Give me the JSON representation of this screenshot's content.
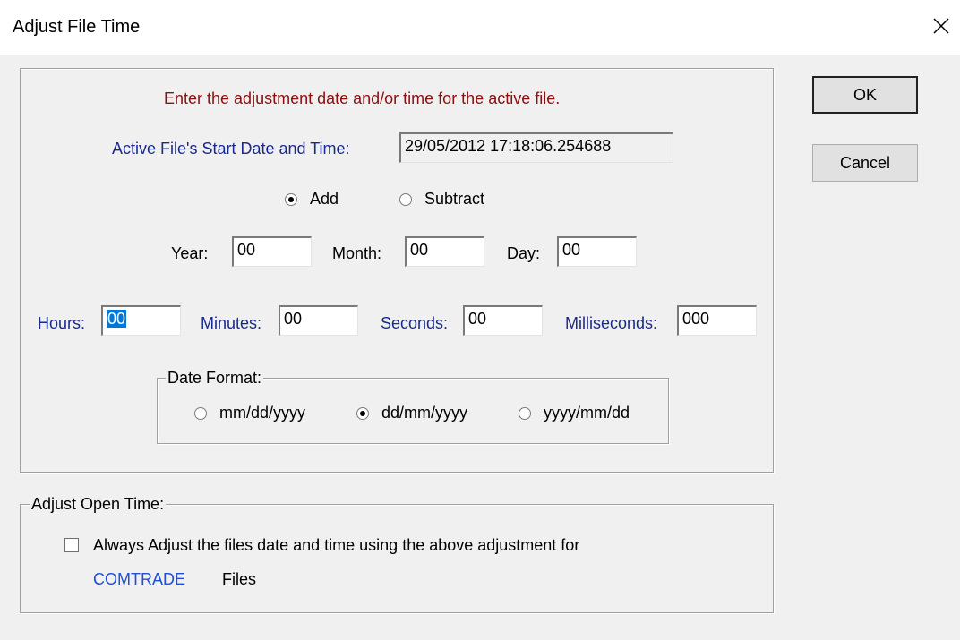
{
  "window": {
    "title": "Adjust File Time"
  },
  "dialog": {
    "instruction": "Enter the adjustment date and/or time for the active file.",
    "start_label": "Active File's Start Date and Time:",
    "start_value": "29/05/2012 17:18:06.254688",
    "operation": {
      "add_label": "Add",
      "subtract_label": "Subtract",
      "selected": "Add"
    },
    "date_fields": {
      "year_label": "Year:",
      "year_value": "00",
      "month_label": "Month:",
      "month_value": "00",
      "day_label": "Day:",
      "day_value": "00"
    },
    "time_fields": {
      "hours_label": "Hours:",
      "hours_value": "00",
      "minutes_label": "Minutes:",
      "minutes_value": "00",
      "seconds_label": "Seconds:",
      "seconds_value": "00",
      "ms_label": "Milliseconds:",
      "ms_value": "000"
    },
    "date_format": {
      "label": "Date Format:",
      "options": [
        "mm/dd/yyyy",
        "dd/mm/yyyy",
        "yyyy/mm/dd"
      ],
      "selected": "dd/mm/yyyy"
    },
    "open_time": {
      "label": "Adjust Open Time:",
      "checkbox_label": "Always Adjust the files date and time using the above adjustment for",
      "checked": false,
      "file_type": "COMTRADE",
      "files_word": "Files"
    }
  },
  "buttons": {
    "ok": "OK",
    "cancel": "Cancel"
  },
  "colors": {
    "instruction": "#8b1010",
    "label_blue": "#1a2a8c",
    "link_blue": "#1f4fd8",
    "selection": "#0078d7"
  }
}
